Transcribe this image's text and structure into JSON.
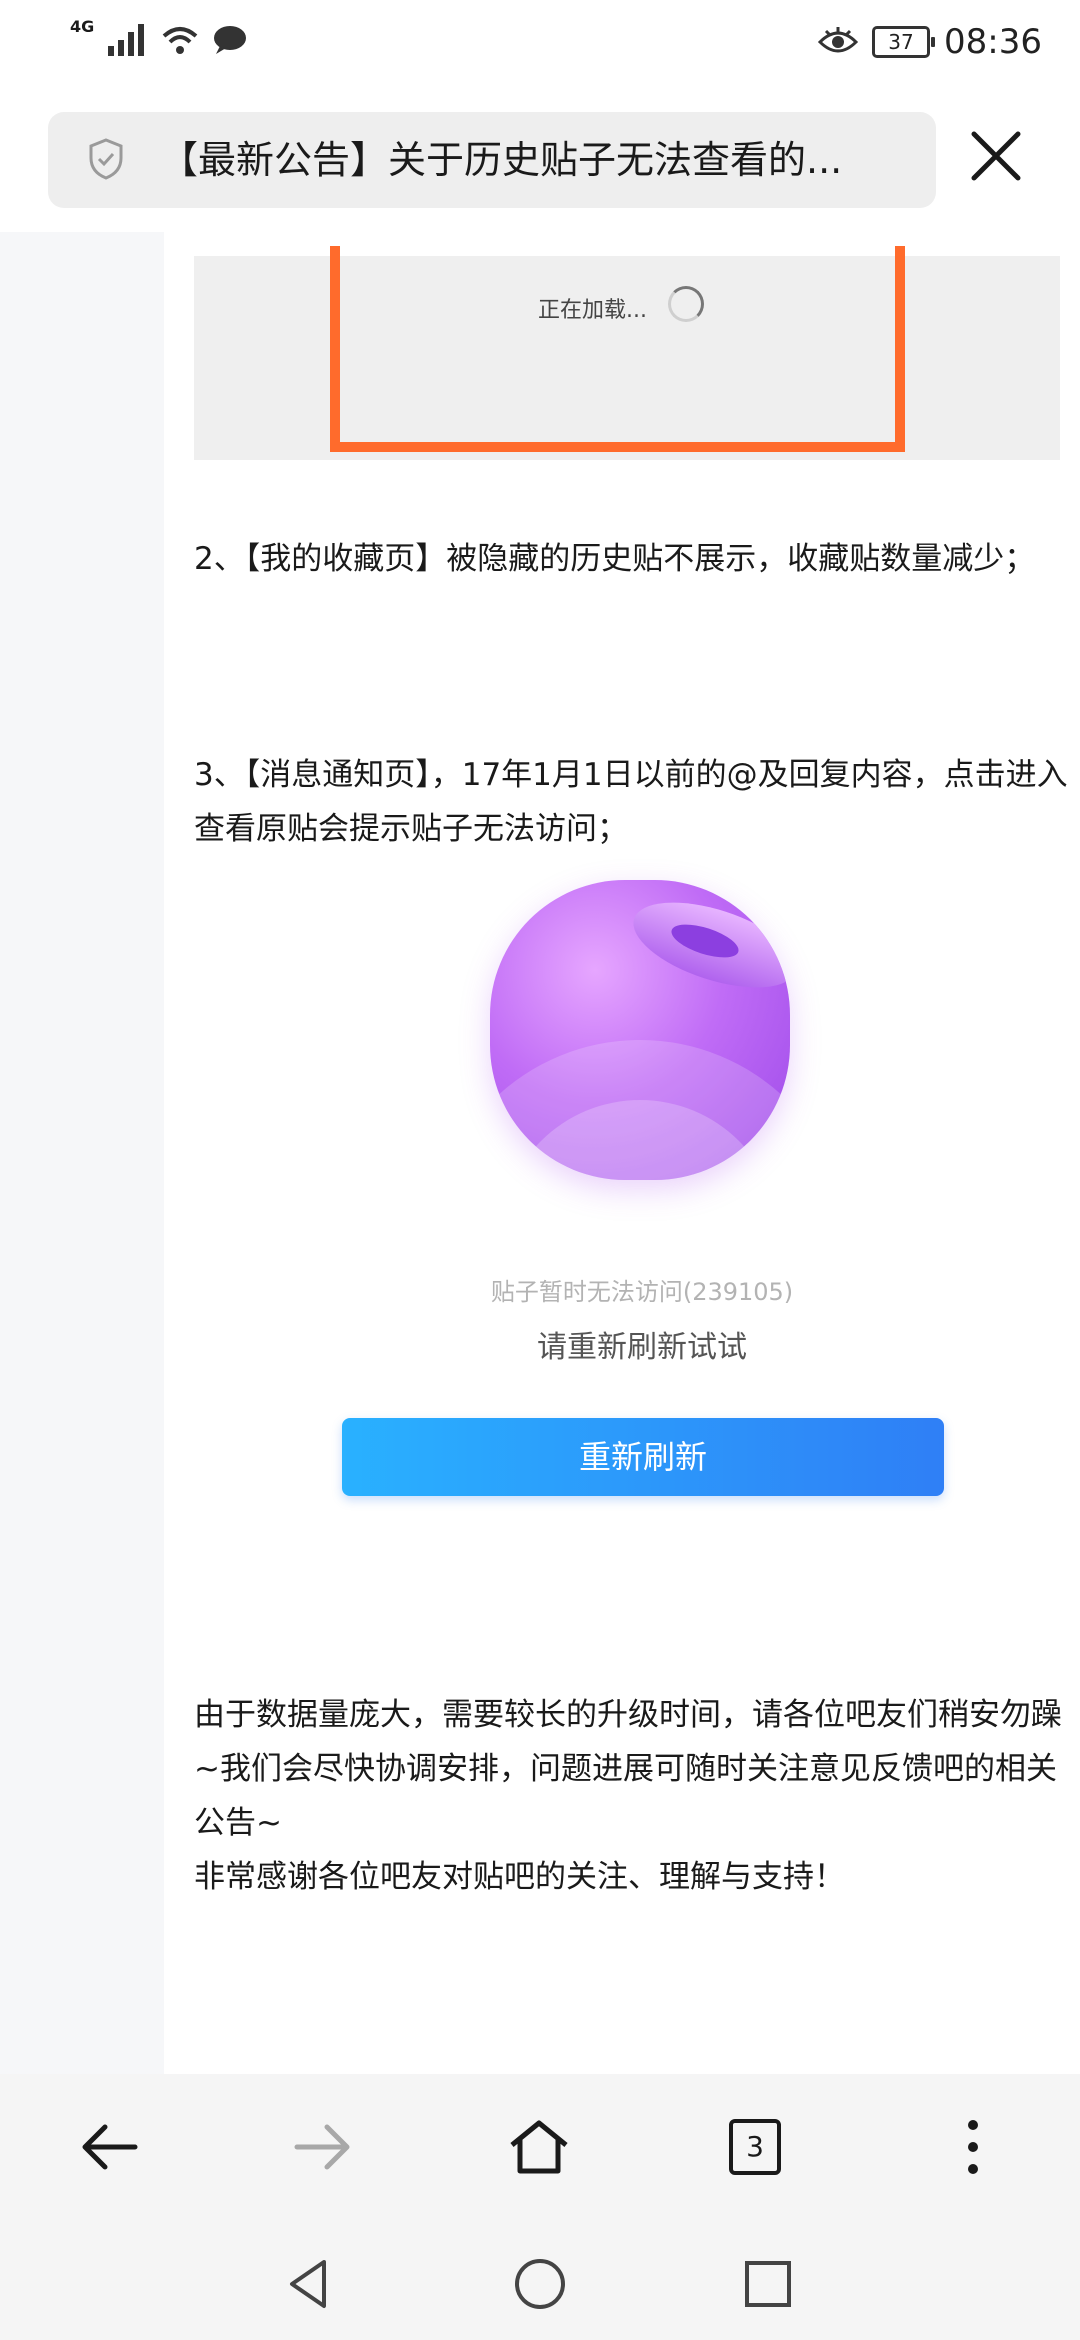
{
  "status_bar": {
    "network": "4G",
    "battery": "37",
    "time": "08:36"
  },
  "address_bar": {
    "title": "【最新公告】关于历史贴子无法查看的..."
  },
  "article": {
    "screenshot_loading": "正在加载...",
    "para2": "2、【我的收藏页】被隐藏的历史贴不展示，收藏贴数量减少；",
    "para3": "3、【消息通知页】，17年1月1日以前的@及回复内容，点击进入查看原贴会提示贴子无法访问；",
    "error_code": "贴子暂时无法访问(239105)",
    "error_message": "请重新刷新试试",
    "refresh_button": "重新刷新",
    "para_end1": "由于数据量庞大，需要较长的升级时间，请各位吧友们稍安勿躁~我们会尽快协调安排，问题进展可随时关注意见反馈吧的相关公告~",
    "para_end2": "非常感谢各位吧友对贴吧的关注、理解与支持！"
  },
  "toolbar": {
    "tab_count": "3"
  },
  "colors": {
    "accent_orange": "#ff6b2c",
    "button_blue_start": "#29b1ff",
    "button_blue_end": "#2f7ff6",
    "orb_purple": "#c06cf6"
  },
  "icons": [
    "signal-icon",
    "wifi-icon",
    "message-icon",
    "eye-icon",
    "shield-icon",
    "close-icon",
    "back-arrow-icon",
    "forward-arrow-icon",
    "home-icon",
    "more-icon",
    "nav-back-icon",
    "nav-home-icon",
    "nav-recents-icon"
  ]
}
